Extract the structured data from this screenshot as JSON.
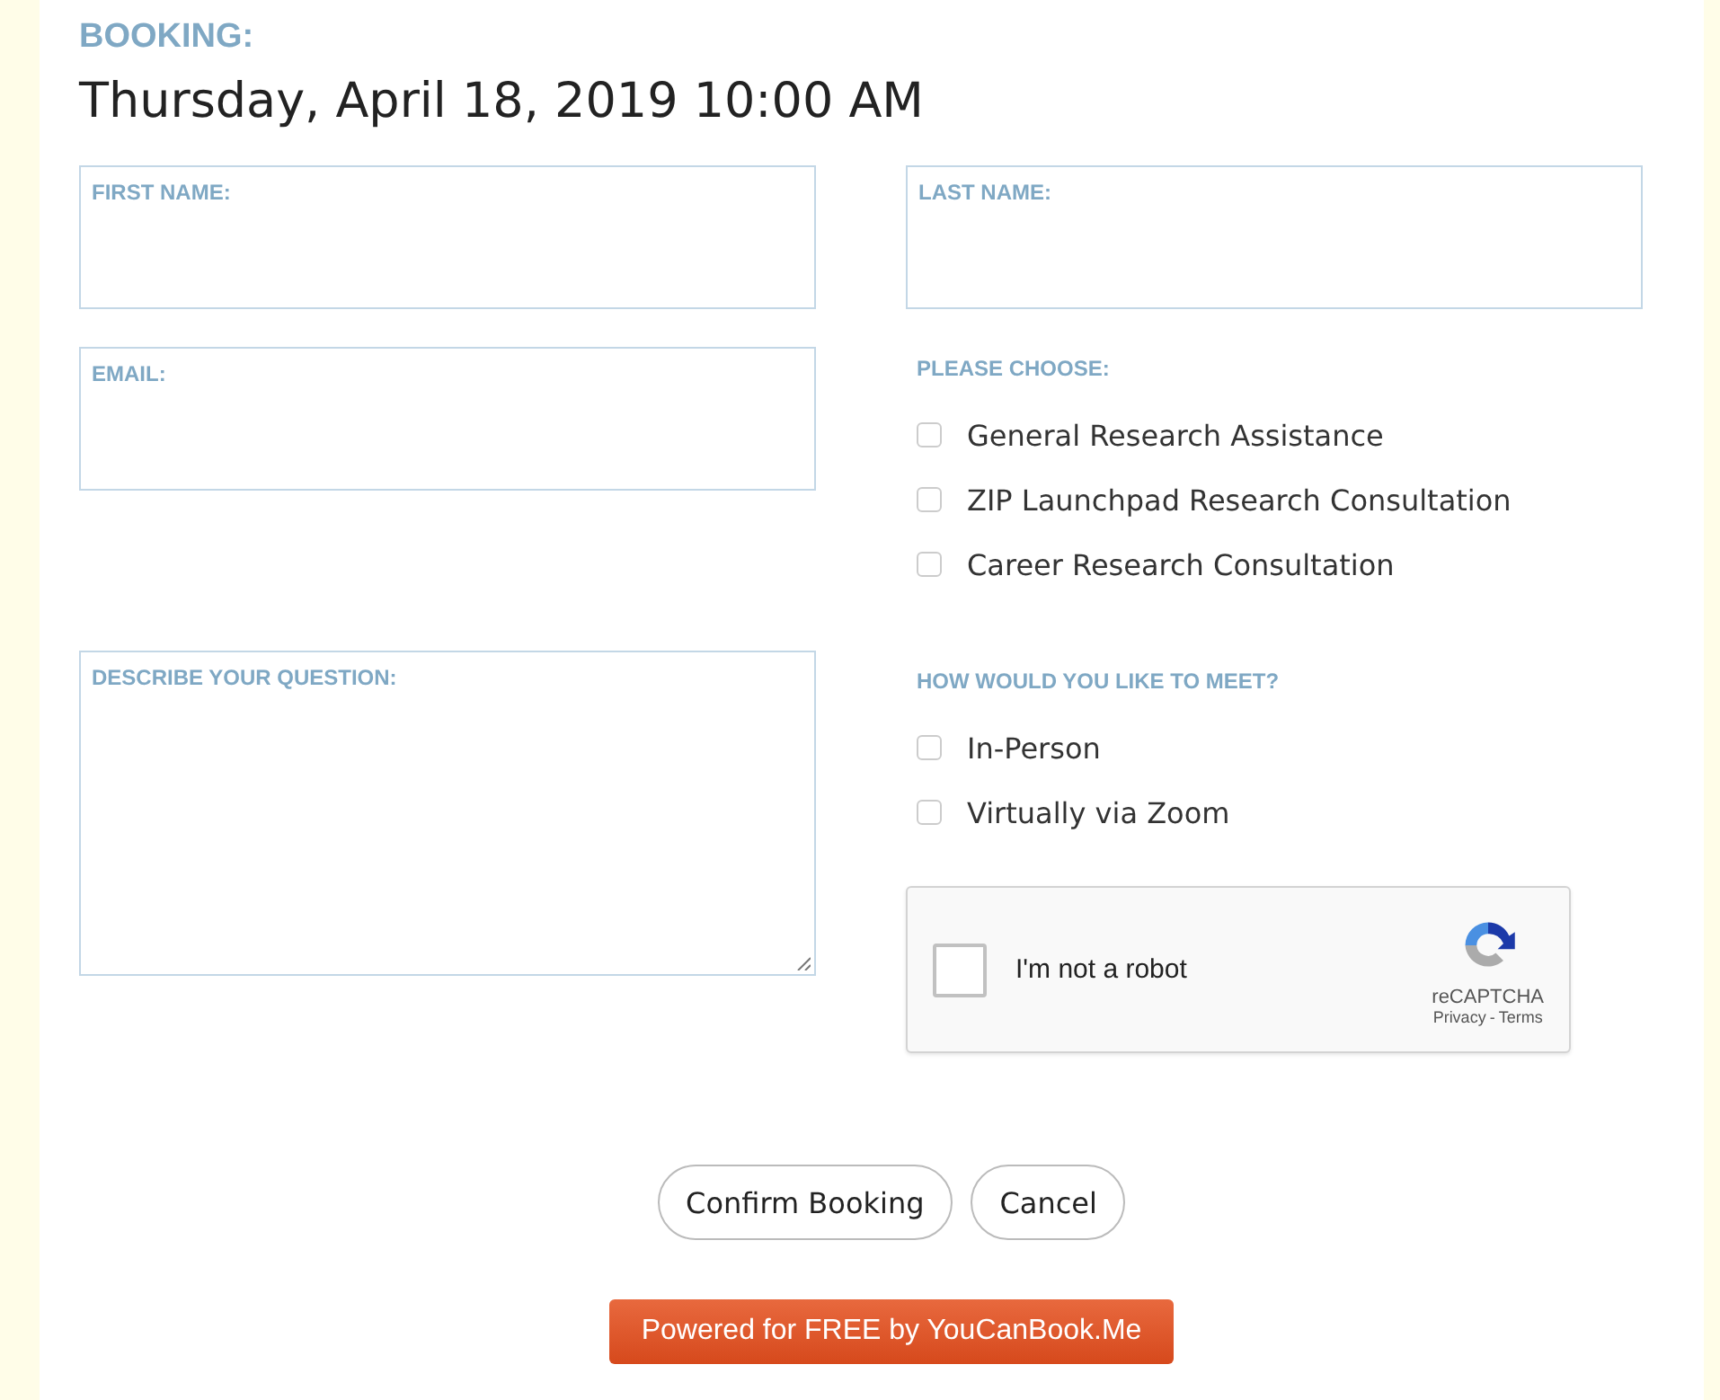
{
  "booking": {
    "label": "BOOKING:",
    "datetime": "Thursday, April 18, 2019 10:00 AM"
  },
  "fields": {
    "first_name": {
      "label": "FIRST NAME:"
    },
    "last_name": {
      "label": "LAST NAME:"
    },
    "email": {
      "label": "EMAIL:"
    },
    "question": {
      "label": "DESCRIBE YOUR QUESTION:"
    }
  },
  "choice_groups": [
    {
      "title": "PLEASE CHOOSE:",
      "options": [
        {
          "label": "General Research Assistance",
          "checked": false
        },
        {
          "label": "ZIP Launchpad Research Consultation",
          "checked": false
        },
        {
          "label": "Career Research Consultation",
          "checked": false
        }
      ]
    },
    {
      "title": "HOW WOULD YOU LIKE TO MEET?",
      "options": [
        {
          "label": "In-Person",
          "checked": false
        },
        {
          "label": "Virtually via Zoom",
          "checked": false
        }
      ]
    }
  ],
  "captcha": {
    "label": "I'm not a robot",
    "checked": false,
    "brand": "reCAPTCHA",
    "privacy": "Privacy",
    "separator": "-",
    "terms": "Terms"
  },
  "buttons": [
    "Confirm Booking",
    "Cancel"
  ],
  "powered": "Powered for FREE by YouCanBook.Me"
}
